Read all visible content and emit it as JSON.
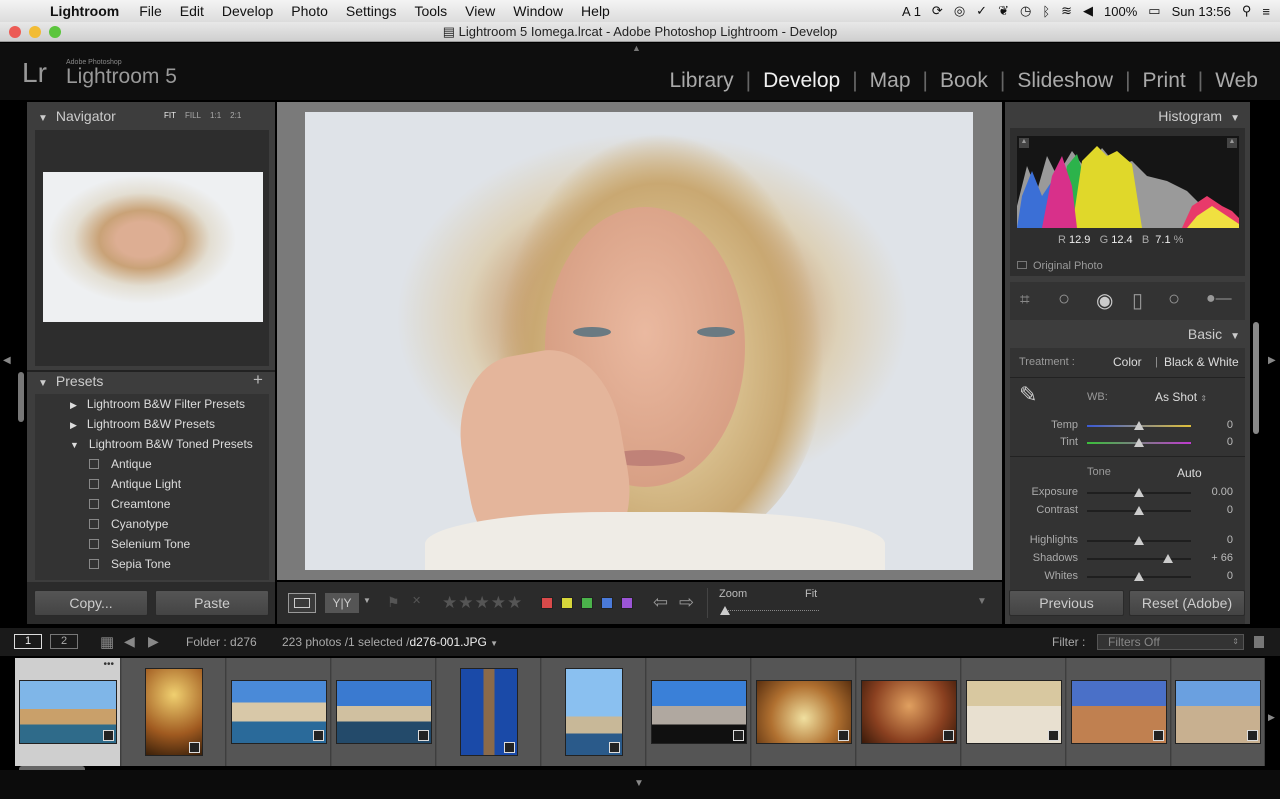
{
  "menubar": {
    "app": "Lightroom",
    "items": [
      "File",
      "Edit",
      "Develop",
      "Photo",
      "Settings",
      "Tools",
      "View",
      "Window",
      "Help"
    ],
    "status": {
      "adobe": "1",
      "battery": "100%",
      "clock": "Sun 13:56"
    }
  },
  "window": {
    "title": "Lightroom 5 Iomega.lrcat - Adobe Photoshop Lightroom - Develop"
  },
  "logo": {
    "lr": "Lr",
    "sub": "Adobe Photoshop",
    "name": "Lightroom 5"
  },
  "modules": [
    "Library",
    "Develop",
    "Map",
    "Book",
    "Slideshow",
    "Print",
    "Web"
  ],
  "navigator": {
    "title": "Navigator",
    "zoom": [
      "FIT",
      "FILL",
      "1:1",
      "2:1"
    ]
  },
  "presets": {
    "title": "Presets",
    "folders": [
      "Lightroom B&W Filter Presets",
      "Lightroom B&W Presets",
      "Lightroom B&W Toned Presets"
    ],
    "items": [
      "Antique",
      "Antique Light",
      "Creamtone",
      "Cyanotype",
      "Selenium Tone",
      "Sepia Tone"
    ]
  },
  "left_buttons": {
    "copy": "Copy...",
    "paste": "Paste"
  },
  "histogram": {
    "title": "Histogram",
    "r_label": "R",
    "r": "12.9",
    "g_label": "G",
    "g": "12.4",
    "b_label": "B",
    "b": "7.1",
    "pct": "%",
    "original": "Original Photo"
  },
  "basic": {
    "title": "Basic",
    "treatment_label": "Treatment :",
    "color": "Color",
    "bw": "Black & White",
    "wb_label": "WB:",
    "wb_value": "As Shot",
    "tone": "Tone",
    "auto": "Auto",
    "sliders": [
      {
        "label": "Temp",
        "value": "0",
        "pos": 0.5
      },
      {
        "label": "Tint",
        "value": "0",
        "pos": 0.5
      },
      {
        "label": "Exposure",
        "value": "0.00",
        "pos": 0.5
      },
      {
        "label": "Contrast",
        "value": "0",
        "pos": 0.5
      },
      {
        "label": "Highlights",
        "value": "0",
        "pos": 0.5
      },
      {
        "label": "Shadows",
        "value": "+ 66",
        "pos": 0.78
      },
      {
        "label": "Whites",
        "value": "0",
        "pos": 0.5
      }
    ]
  },
  "right_buttons": {
    "previous": "Previous",
    "reset": "Reset (Adobe)"
  },
  "toolbar": {
    "zoom": "Zoom",
    "fit": "Fit",
    "colors": [
      "#d94a4a",
      "#d6d63a",
      "#4bb34b",
      "#4a7ad9",
      "#9b55d6"
    ]
  },
  "filmstrip": {
    "view1": "1",
    "view2": "2",
    "folder": "Folder : d276",
    "count": "223 photos /1 selected /",
    "filename": "d276-001.JPG",
    "filter_label": "Filter :",
    "filter_value": "Filters Off"
  }
}
